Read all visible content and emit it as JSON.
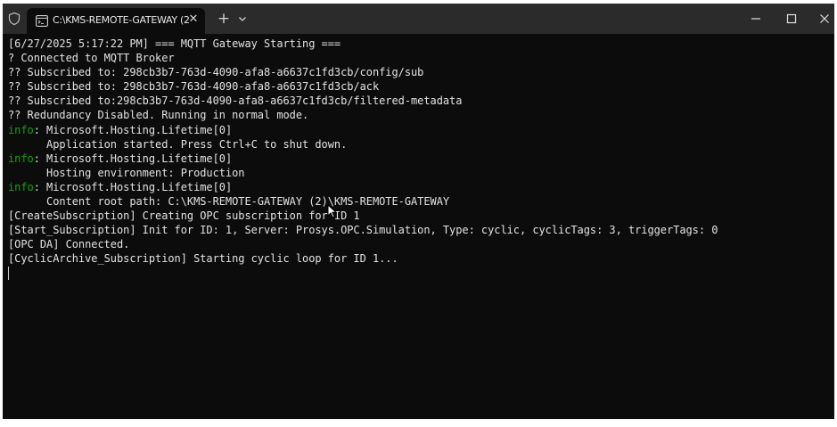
{
  "window": {
    "tab_title": "C:\\KMS-REMOTE-GATEWAY (2",
    "tab_close": "✕",
    "new_tab": "+"
  },
  "console": {
    "lines": [
      {
        "text": "[6/27/2025 5:17:22 PM] === MQTT Gateway Starting ==="
      },
      {
        "text": "? Connected to MQTT Broker"
      },
      {
        "text": "?? Subscribed to: 298cb3b7-763d-4090-afa8-a6637c1fd3cb/config/sub"
      },
      {
        "text": "?? Subscribed to: 298cb3b7-763d-4090-afa8-a6637c1fd3cb/ack"
      },
      {
        "text": "?? Subscribed to:298cb3b7-763d-4090-afa8-a6637c1fd3cb/filtered-metadata"
      },
      {
        "text": "?? Redundancy Disabled. Running in normal mode."
      },
      {
        "prefix": "info",
        "text": ": Microsoft.Hosting.Lifetime[0]"
      },
      {
        "text": "      Application started. Press Ctrl+C to shut down."
      },
      {
        "prefix": "info",
        "text": ": Microsoft.Hosting.Lifetime[0]"
      },
      {
        "text": "      Hosting environment: Production"
      },
      {
        "prefix": "info",
        "text": ": Microsoft.Hosting.Lifetime[0]"
      },
      {
        "text": "      Content root path: C:\\KMS-REMOTE-GATEWAY (2)\\KMS-REMOTE-GATEWAY"
      },
      {
        "text": "[CreateSubscription] Creating OPC subscription for ID 1"
      },
      {
        "text": "[Start_Subscription] Init for ID: 1, Server: Prosys.OPC.Simulation, Type: cyclic, cyclicTags: 3, triggerTags: 0"
      },
      {
        "text": "[OPC DA] Connected."
      },
      {
        "text": "[CyclicArchive_Subscription] Starting cyclic loop for ID 1..."
      }
    ]
  },
  "colors": {
    "background": "#0c0c0c",
    "titlebar": "#2b2b2b",
    "text": "#e2e2e2",
    "info": "#13a10e"
  }
}
